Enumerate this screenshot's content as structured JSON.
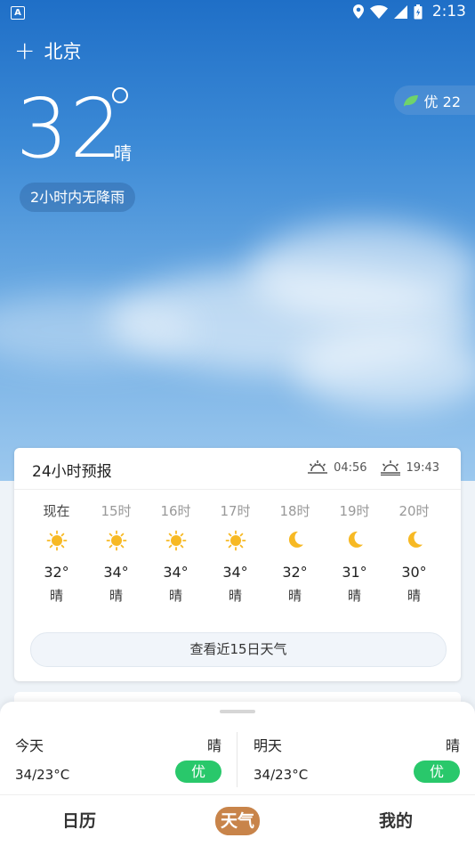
{
  "status_bar": {
    "time": "2:13",
    "app_icon_label": "A"
  },
  "header": {
    "add_icon": "plus-icon",
    "city": "北京"
  },
  "current": {
    "temperature": "32",
    "condition": "晴",
    "rain_note": "2小时内无降雨",
    "aqi_label": "优 22"
  },
  "forecast_24h": {
    "title": "24小时预报",
    "sunrise": "04:56",
    "sunset": "19:43",
    "hours": [
      {
        "label": "现在",
        "icon": "sun-icon",
        "temp": "32°",
        "cond": "晴"
      },
      {
        "label": "15时",
        "icon": "sun-icon",
        "temp": "34°",
        "cond": "晴"
      },
      {
        "label": "16时",
        "icon": "sun-icon",
        "temp": "34°",
        "cond": "晴"
      },
      {
        "label": "17时",
        "icon": "sun-icon",
        "temp": "34°",
        "cond": "晴"
      },
      {
        "label": "18时",
        "icon": "moon-icon",
        "temp": "32°",
        "cond": "晴"
      },
      {
        "label": "19时",
        "icon": "moon-icon",
        "temp": "31°",
        "cond": "晴"
      },
      {
        "label": "20时",
        "icon": "moon-icon",
        "temp": "30°",
        "cond": "晴"
      }
    ],
    "button_label": "查看近15日天气"
  },
  "daily": {
    "today": {
      "name": "今天",
      "cond": "晴",
      "range": "34/23°C",
      "aqi": "优"
    },
    "tomorrow": {
      "name": "明天",
      "cond": "晴",
      "range": "34/23°C",
      "aqi": "优"
    }
  },
  "nav": {
    "calendar": "日历",
    "weather": "天气",
    "mine": "我的",
    "active": "天气"
  },
  "colors": {
    "aqi_green": "#29c86b",
    "active_tab": "#c8844a",
    "sun": "#f7b924"
  }
}
